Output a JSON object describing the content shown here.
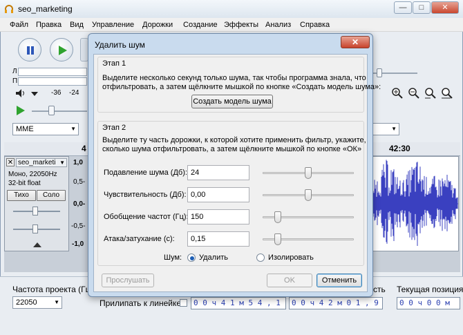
{
  "window": {
    "title": "seo_marketing",
    "controls": {
      "minimize": "—",
      "maximize": "□",
      "close": "✕"
    }
  },
  "menu": [
    "Файл",
    "Правка",
    "Вид",
    "Управление",
    "Дорожки",
    "Создание",
    "Эффекты",
    "Анализ",
    "Справка"
  ],
  "meters": {
    "left_label": "Л",
    "right_label": "П",
    "scale": [
      "-36",
      "-24"
    ]
  },
  "device": {
    "host": "MME"
  },
  "ruler": {
    "left_mark": "4",
    "time_mark": "42:30"
  },
  "track": {
    "name": "seo_marketi",
    "info_line1": "Моно, 22050Hz",
    "info_line2": "32-bit float",
    "mute_label": "Тихо",
    "solo_label": "Соло",
    "scale": [
      "1,0",
      "0,5-",
      "0,0-",
      "-0,5-",
      "-1,0"
    ]
  },
  "bottom": {
    "project_rate_label": "Частота проекта (Гц):",
    "project_rate_value": "22050",
    "snap_label": "Прилипать к линейке",
    "sel_start": "0 0 ч 4 1 м 5 4 , 1 8 0 с",
    "sel_end": "0 0 ч 4 2 м 0 1 , 9 8 7 с",
    "audio_pos_label": "Текущая позиция",
    "audio_pos_value": "0 0 ч 0 0 м",
    "partial_label": "сть"
  },
  "dialog": {
    "title": "Удалить шум",
    "close": "✕",
    "step1": {
      "title": "Этап 1",
      "text_line1": "Выделите несколько секунд только шума, так чтобы программа знала, что",
      "text_line2": "отфильтровать, а затем щёлкните мышкой по кнопке «Создать модель шума»:",
      "button": "Создать модель шума"
    },
    "step2": {
      "title": "Этап 2",
      "text_line1": "Выделите ту часть дорожки, к которой хотите применить фильтр, укажите,",
      "text_line2": "сколько шума отфильтровать, а затем щёлкните мышкой по кнопке «ОК»",
      "params": [
        {
          "label": "Подавление шума (Дб):",
          "value": "24",
          "slider_fraction": 0.5
        },
        {
          "label": "Чувствительность (Дб):",
          "value": "0,00",
          "slider_fraction": 0.5
        },
        {
          "label": "Обобщение частот (Гц):",
          "value": "150",
          "slider_fraction": 0.17
        },
        {
          "label": "Атака/затухание (с):",
          "value": "0,15",
          "slider_fraction": 0.17
        }
      ],
      "noise_label": "Шум:",
      "noise_options": [
        {
          "label": "Удалить",
          "selected": true
        },
        {
          "label": "Изолировать",
          "selected": false
        }
      ]
    },
    "buttons": {
      "preview": "Прослушать",
      "ok": "OK",
      "cancel": "Отменить"
    }
  },
  "colors": {
    "wave": "#3a40c0",
    "timecode": "#2a3fb0",
    "play_green": "#2fa32f",
    "pause_blue": "#2c56b8"
  }
}
